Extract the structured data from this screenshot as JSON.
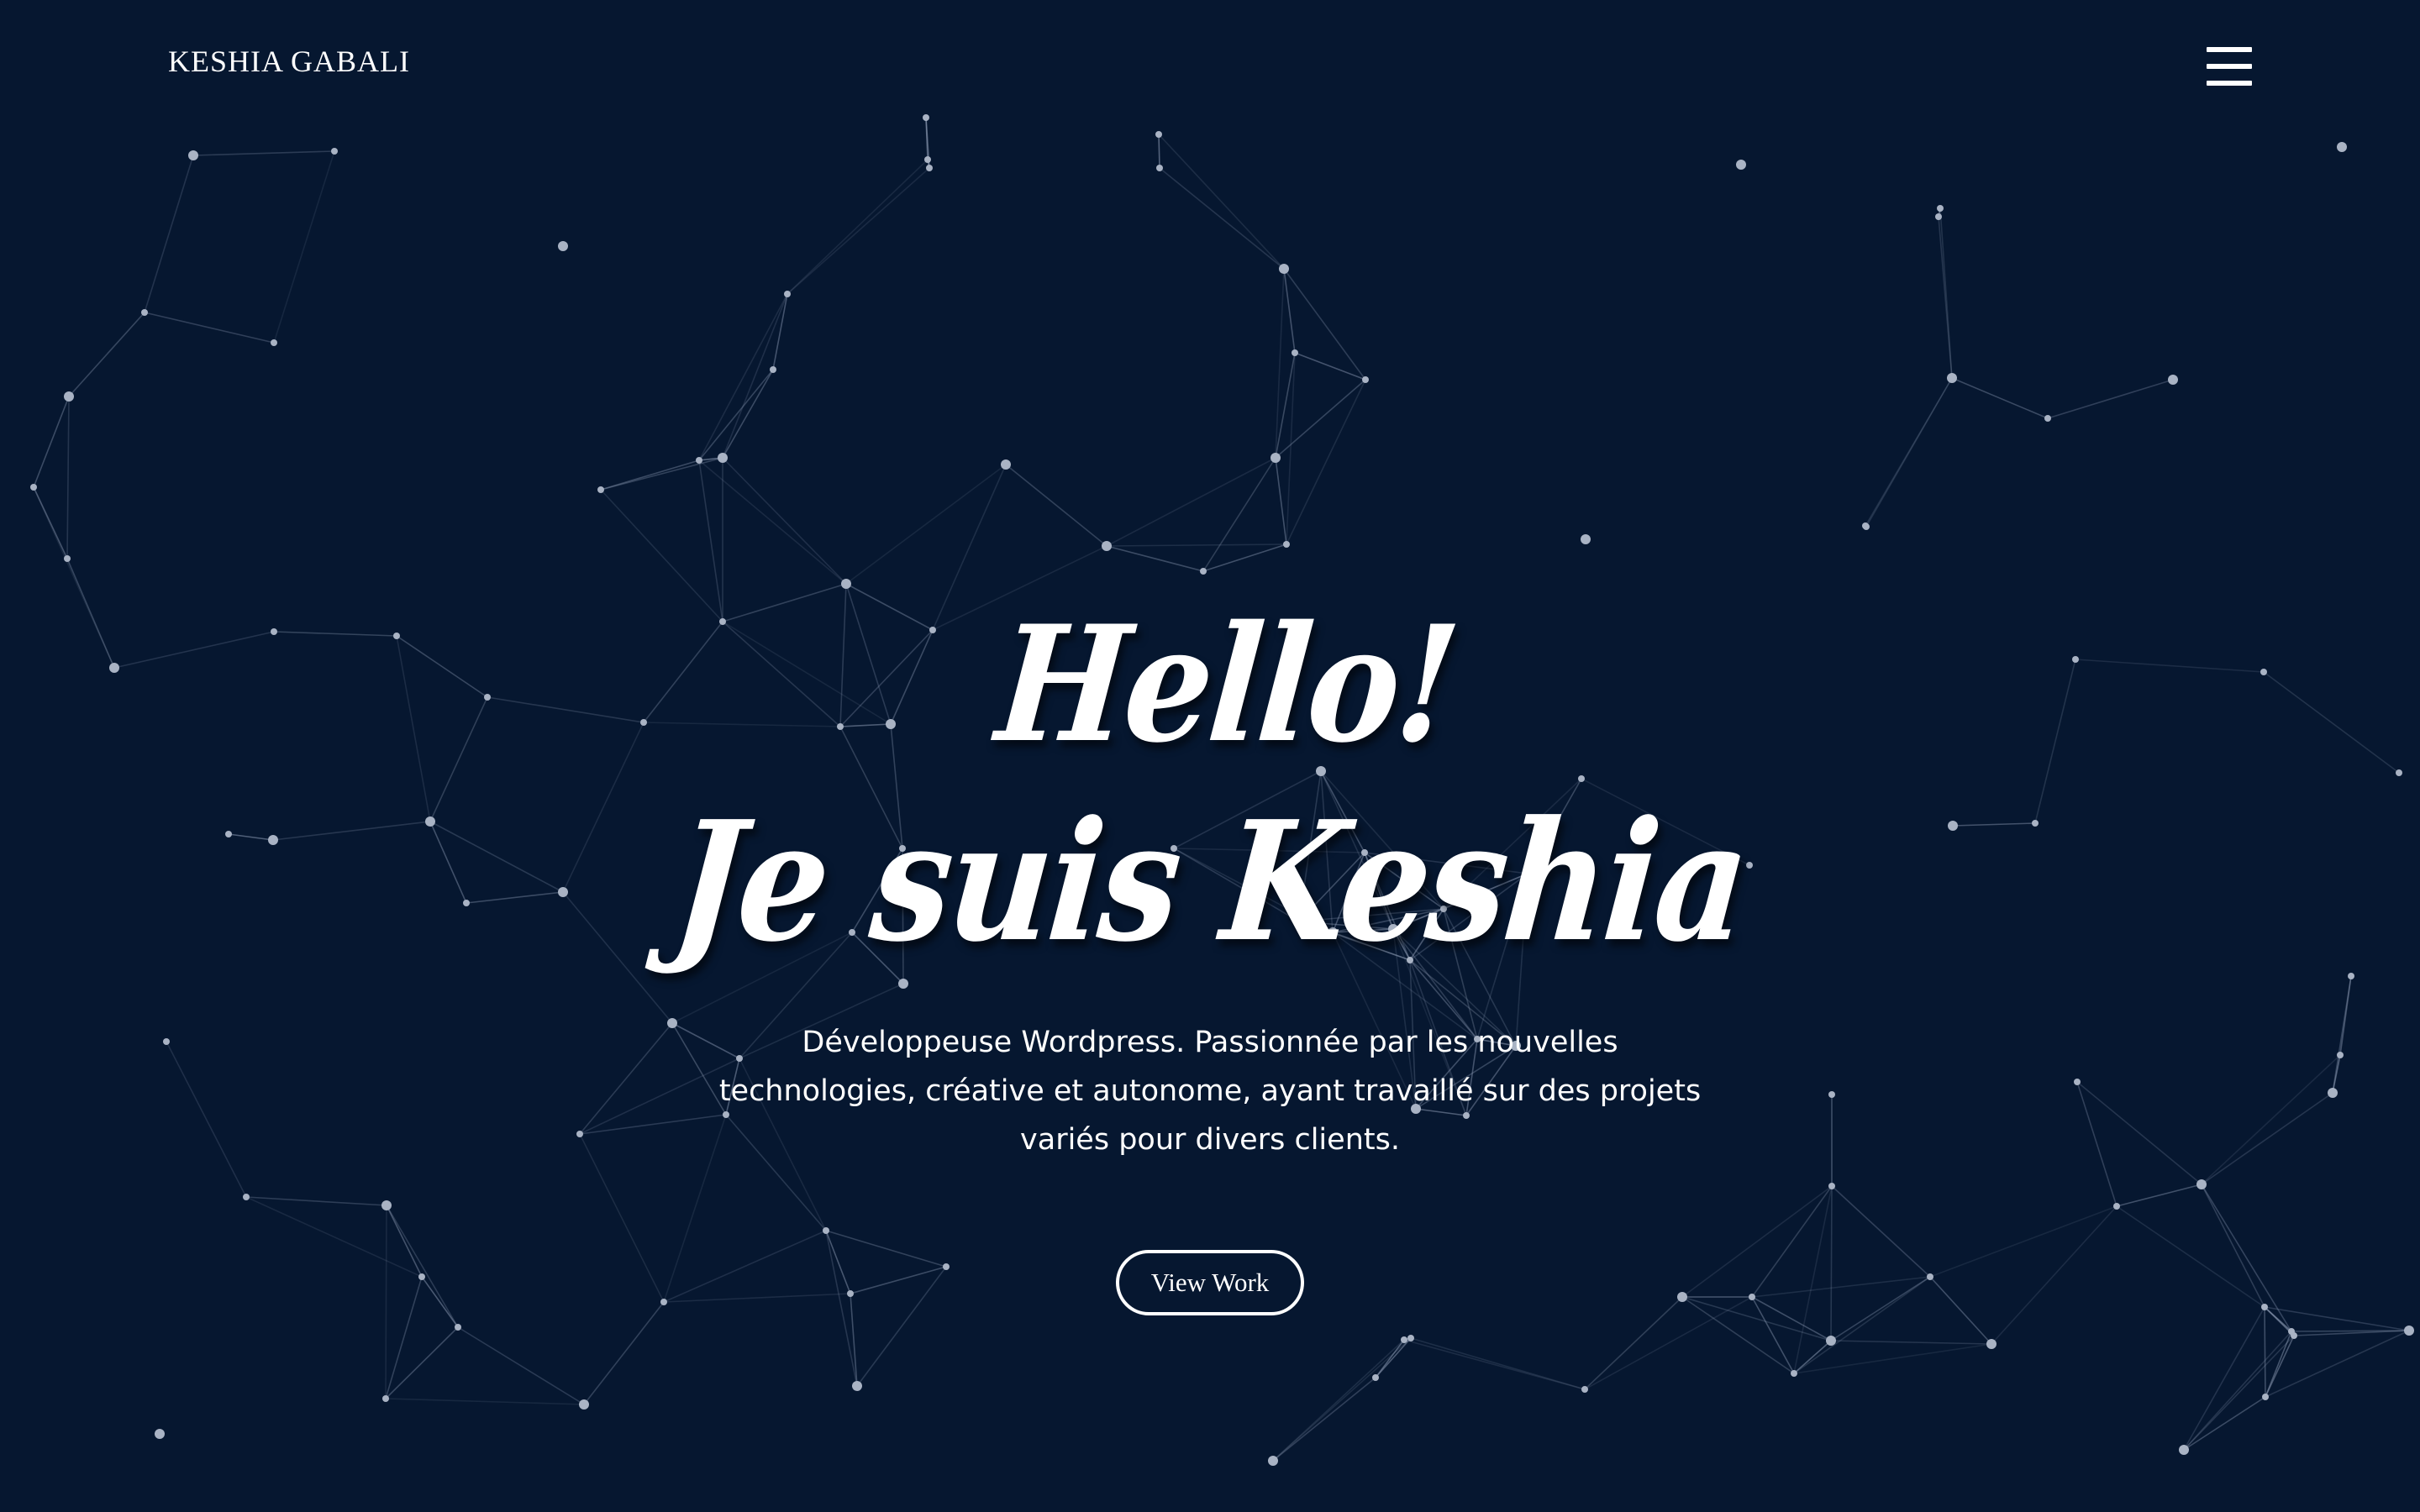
{
  "nav": {
    "brand": "KESHIA GABALI",
    "menu_icon": "hamburger-menu-icon"
  },
  "hero": {
    "greeting": "Hello!",
    "headline": "Je suis Keshia",
    "description": "Développeuse Wordpress. Passionnée par les nouvelles technologies, créative et autonome, ayant travaillé sur des projets variés pour divers clients.",
    "cta_label": "View Work"
  },
  "colors": {
    "background": "#061730",
    "text": "#ffffff",
    "network_line": "#8d9bb4",
    "network_node": "#a9b3c4"
  },
  "background_graphic": "particle-network"
}
